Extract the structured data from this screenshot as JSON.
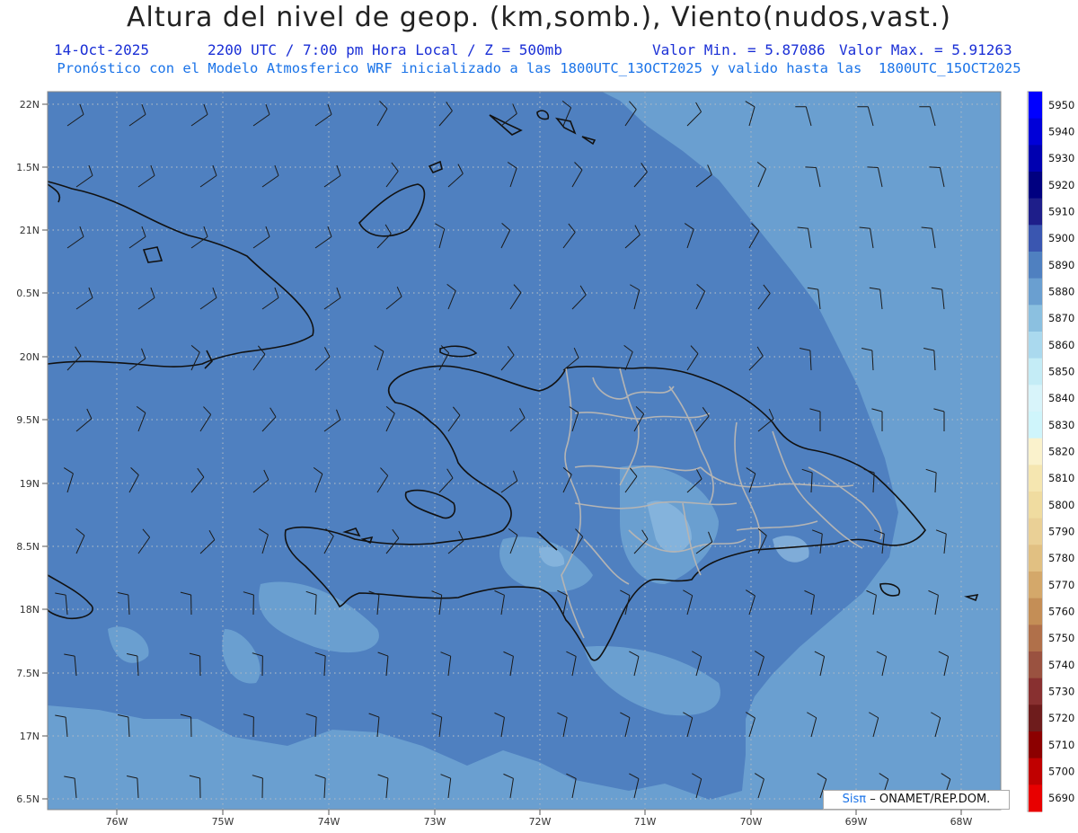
{
  "header": {
    "title": "Altura del nivel de geop. (km,somb.), Viento(nudos,vast.)",
    "date": "14-Oct-2025",
    "time": "2200 UTC / 7:00 pm Hora Local / Z = 500mb",
    "min": "Valor Min. = 5.87086",
    "max": "Valor Max. = 5.91263",
    "forecast": "Pronóstico con el Modelo Atmosferico WRF inicializado a las 1800UTC_13OCT2025 y valido hasta las  1800UTC_15OCT2025"
  },
  "map": {
    "lat_labels": [
      "22N",
      "1.5N",
      "21N",
      "0.5N",
      "20N",
      "9.5N",
      "19N",
      "8.5N",
      "18N",
      "7.5N",
      "17N",
      "6.5N"
    ],
    "lon_labels": [
      "76W",
      "75W",
      "74W",
      "73W",
      "72W",
      "71W",
      "70W",
      "69W",
      "68W"
    ],
    "colors": {
      "main": "#4f80c0",
      "outer": "#6a9fd0",
      "light": "#8bb8df",
      "coast": "#111111",
      "province": "#b4b4b4",
      "grid": "#a6b6c6",
      "barb": "#1a1a1a"
    }
  },
  "colorbar": {
    "levels": [
      "5950",
      "5940",
      "5930",
      "5920",
      "5910",
      "5900",
      "5890",
      "5880",
      "5870",
      "5860",
      "5850",
      "5840",
      "5830",
      "5820",
      "5810",
      "5800",
      "5790",
      "5780",
      "5770",
      "5760",
      "5750",
      "5740",
      "5730",
      "5720",
      "5710",
      "5700",
      "5690"
    ],
    "colors": [
      "#0000ff",
      "#0000d8",
      "#0000b0",
      "#000080",
      "#1e1e8a",
      "#3a56b0",
      "#4f80c0",
      "#6a9fd0",
      "#8bc0e0",
      "#aad9ee",
      "#c4ecf6",
      "#d8f4fa",
      "#cff5fb",
      "#faf2cc",
      "#f5e6b0",
      "#f0dca0",
      "#ead096",
      "#e1c082",
      "#d4a86a",
      "#c48e56",
      "#b0704a",
      "#9a5240",
      "#883030",
      "#6e1c1c",
      "#8c0000",
      "#c00000",
      "#e80000"
    ]
  },
  "credit": {
    "sis": "Sisπ",
    "text": "– ONAMET/REP.DOM."
  }
}
